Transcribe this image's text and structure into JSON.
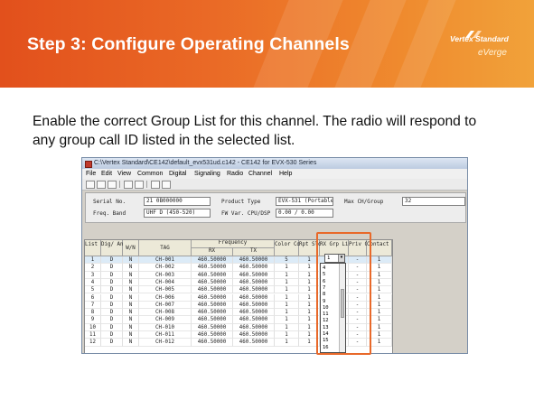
{
  "slide": {
    "title": "Step 3: Configure Operating Channels",
    "brand_name": "Vertex Standard",
    "brand_sub": "eVerge",
    "body": "Enable the correct Group List for this channel. The radio will respond to any group call ID listed in the selected list."
  },
  "colors": {
    "header_start": "#e2501c",
    "header_end": "#f1a23a",
    "highlight": "#e8692a"
  },
  "window": {
    "title": "C:\\Vertex Standard\\CE142\\default_evx531ud.c142 - CE142 for EVX-530 Series",
    "menu": [
      "File",
      "Edit",
      "View",
      "Common",
      "Digital",
      "Signaling",
      "Radio",
      "Channel",
      "Help"
    ],
    "info": {
      "serial_label": "Serial No.",
      "serial_value": "21 0B000000",
      "band_label": "Freq. Band",
      "band_value": "UHF D (450-520)",
      "product_label": "Product Type",
      "product_value": "EVX-531 (Portable)",
      "fw_label": "FW Var. CPU/DSP",
      "fw_value": "0.00 / 0.00",
      "maxch_label": "Max CH/Group",
      "maxch_value": "32"
    }
  },
  "grid": {
    "headers": {
      "list_no": "List No.",
      "dig_ana": "Dig/ Ana",
      "wn": "W/N",
      "tag": "TAG",
      "frequency": "Frequency",
      "rx": "RX",
      "tx": "TX",
      "color_code": "Color Code",
      "rpt_slot": "Rpt Slot",
      "rx_grp_list": "RX Grp List",
      "priv_cfm": "Priv Cfm.",
      "contact_list": "Contact List"
    },
    "rows": [
      {
        "no": "1",
        "da": "D",
        "wn": "N",
        "tag": "CH-001",
        "rx": "460.50000",
        "tx": "460.50000",
        "cc": "5",
        "slot": "1",
        "grp": "1",
        "priv": "-",
        "contact": "1"
      },
      {
        "no": "2",
        "da": "D",
        "wn": "N",
        "tag": "CH-002",
        "rx": "460.50000",
        "tx": "460.50000",
        "cc": "1",
        "slot": "1",
        "grp": "",
        "priv": "-",
        "contact": "1"
      },
      {
        "no": "3",
        "da": "D",
        "wn": "N",
        "tag": "CH-003",
        "rx": "460.50000",
        "tx": "460.50000",
        "cc": "1",
        "slot": "1",
        "grp": "",
        "priv": "-",
        "contact": "1"
      },
      {
        "no": "4",
        "da": "D",
        "wn": "N",
        "tag": "CH-004",
        "rx": "460.50000",
        "tx": "460.50000",
        "cc": "1",
        "slot": "1",
        "grp": "",
        "priv": "-",
        "contact": "1"
      },
      {
        "no": "5",
        "da": "D",
        "wn": "N",
        "tag": "CH-005",
        "rx": "460.50000",
        "tx": "460.50000",
        "cc": "1",
        "slot": "1",
        "grp": "",
        "priv": "-",
        "contact": "1"
      },
      {
        "no": "6",
        "da": "D",
        "wn": "N",
        "tag": "CH-006",
        "rx": "460.50000",
        "tx": "460.50000",
        "cc": "1",
        "slot": "1",
        "grp": "",
        "priv": "-",
        "contact": "1"
      },
      {
        "no": "7",
        "da": "D",
        "wn": "N",
        "tag": "CH-007",
        "rx": "460.50000",
        "tx": "460.50000",
        "cc": "1",
        "slot": "1",
        "grp": "",
        "priv": "-",
        "contact": "1"
      },
      {
        "no": "8",
        "da": "D",
        "wn": "N",
        "tag": "CH-008",
        "rx": "460.50000",
        "tx": "460.50000",
        "cc": "1",
        "slot": "1",
        "grp": "",
        "priv": "-",
        "contact": "1"
      },
      {
        "no": "9",
        "da": "D",
        "wn": "N",
        "tag": "CH-009",
        "rx": "460.50000",
        "tx": "460.50000",
        "cc": "1",
        "slot": "1",
        "grp": "",
        "priv": "-",
        "contact": "1"
      },
      {
        "no": "10",
        "da": "D",
        "wn": "N",
        "tag": "CH-010",
        "rx": "460.50000",
        "tx": "460.50000",
        "cc": "1",
        "slot": "1",
        "grp": "",
        "priv": "-",
        "contact": "1"
      },
      {
        "no": "11",
        "da": "D",
        "wn": "N",
        "tag": "CH-011",
        "rx": "460.50000",
        "tx": "460.50000",
        "cc": "1",
        "slot": "1",
        "grp": "",
        "priv": "-",
        "contact": "1"
      },
      {
        "no": "12",
        "da": "D",
        "wn": "N",
        "tag": "CH-012",
        "rx": "460.50000",
        "tx": "460.50000",
        "cc": "1",
        "slot": "1",
        "grp": "",
        "priv": "-",
        "contact": "1"
      }
    ],
    "dropdown_value": "1",
    "dropdown_options": [
      "4",
      "5",
      "6",
      "7",
      "8",
      "9",
      "10",
      "11",
      "12",
      "13",
      "14",
      "15",
      "16"
    ]
  }
}
